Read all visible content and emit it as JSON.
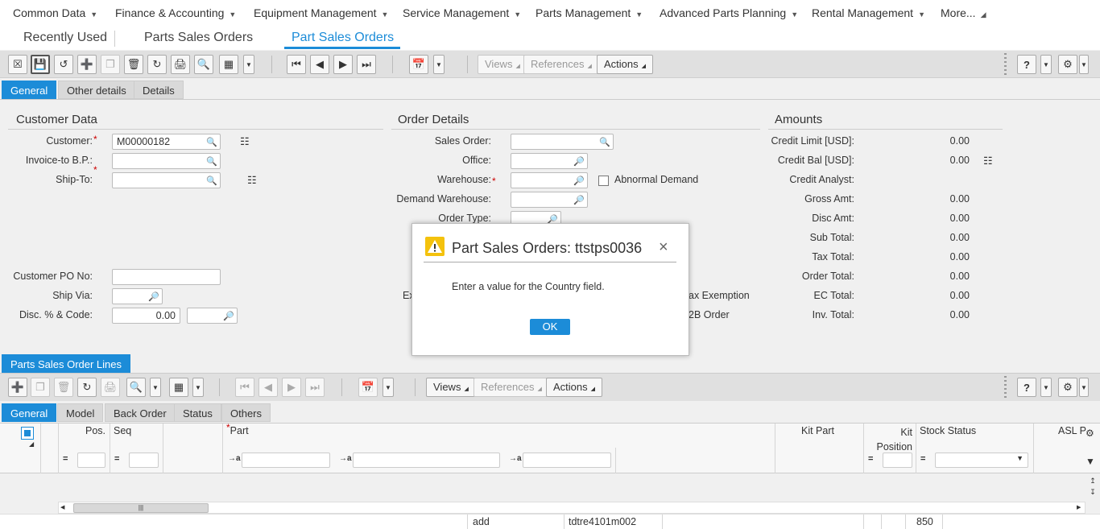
{
  "top_menu": [
    {
      "label": "Common Data"
    },
    {
      "label": "Finance & Accounting"
    },
    {
      "label": "Equipment Management"
    },
    {
      "label": "Service Management"
    },
    {
      "label": "Parts Management"
    },
    {
      "label": "Advanced Parts Planning"
    },
    {
      "label": "Rental Management"
    },
    {
      "label": "More..."
    }
  ],
  "page_tabs": [
    {
      "label": "Recently Used"
    },
    {
      "label": "Parts Sales Orders"
    },
    {
      "label": "Part Sales Orders"
    }
  ],
  "toolbar": {
    "views": "Views",
    "references": "References",
    "actions": "Actions",
    "help": "?"
  },
  "form_tabs": [
    "General",
    "Other details",
    "Details"
  ],
  "customer": {
    "title": "Customer Data",
    "customer_label": "Customer:",
    "customer_value": "M00000182",
    "invoice_label": "Invoice-to B.P.:",
    "shipto_label": "Ship-To:",
    "po_label": "Customer PO No:",
    "shipvia_label": "Ship Via:",
    "disc_label": "Disc. % & Code:",
    "disc_value": "0.00"
  },
  "order": {
    "title": "Order Details",
    "sales_order_label": "Sales Order:",
    "office_label": "Office:",
    "warehouse_label": "Warehouse:",
    "abnormal_label": "Abnormal Demand",
    "demand_wh_label": "Demand Warehouse:",
    "order_type_label": "Order Type:",
    "hidden_label_partial": "Ex",
    "tax_exemption_partial": "ax Exemption",
    "b2b_partial": "2B Order"
  },
  "amounts": {
    "title": "Amounts",
    "rows": [
      {
        "label": "Credit Limit [USD]:",
        "value": "0.00"
      },
      {
        "label": "Credit Bal [USD]:",
        "value": "0.00"
      },
      {
        "label": "Credit Analyst:",
        "value": ""
      },
      {
        "label": "Gross Amt:",
        "value": "0.00"
      },
      {
        "label": "Disc Amt:",
        "value": "0.00"
      },
      {
        "label": "Sub Total:",
        "value": "0.00"
      },
      {
        "label": "Tax Total:",
        "value": "0.00"
      },
      {
        "label": "Order Total:",
        "value": "0.00"
      },
      {
        "label": "EC Total:",
        "value": "0.00"
      },
      {
        "label": "Inv. Total:",
        "value": "0.00"
      }
    ]
  },
  "lines": {
    "title": "Parts Sales Order Lines",
    "tabs": [
      "General",
      "Model",
      "Back Order",
      "Status",
      "Others"
    ],
    "columns": {
      "pos": "Pos.",
      "seq": "Seq",
      "part": "Part",
      "kit_part": "Kit Part",
      "kit_position": "Kit Position",
      "stock_status": "Stock Status",
      "asl": "ASL P"
    },
    "bottom_row": {
      "c1": "add",
      "c2": "tdtre4101m002",
      "c3": "850"
    }
  },
  "dialog": {
    "title": "Part Sales Orders: ttstps0036",
    "message": "Enter a value for the Country field.",
    "ok": "OK"
  }
}
